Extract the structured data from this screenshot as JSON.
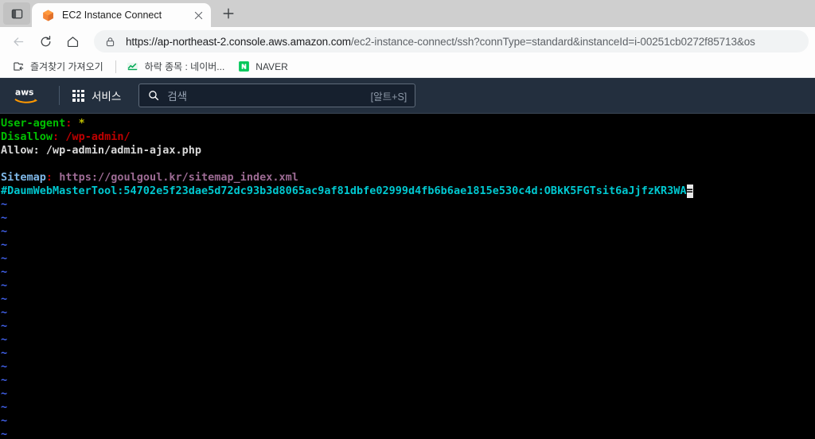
{
  "browser": {
    "tab": {
      "title": "EC2 Instance Connect",
      "favicon": "aws-ec2-cube-icon",
      "close_icon": "close-icon"
    },
    "new_tab_label": "+",
    "tab_search_icon": "tab-search-icon",
    "nav": {
      "back_icon": "back-arrow-icon",
      "reload_icon": "reload-icon",
      "home_icon": "home-icon"
    },
    "omnibox": {
      "lock_icon": "lock-icon",
      "scheme_host": "https://ap-northeast-2.console.aws.amazon.com",
      "path": "/ec2-instance-connect/ssh?connType=standard&instanceId=i-00251cb0272f85713&os"
    },
    "bookmarks": {
      "import_icon": "import-bookmarks-icon",
      "import_label": "즐겨찾기 가져오기",
      "items": [
        {
          "icon": "chart-icon",
          "label": "하락 종목 : 네이버..."
        },
        {
          "icon": "naver-n-icon",
          "label": "NAVER"
        }
      ]
    }
  },
  "aws": {
    "logo": "aws-logo",
    "services_grid_icon": "grid-menu-icon",
    "services_label": "서비스",
    "search": {
      "icon": "search-icon",
      "placeholder": "검색",
      "shortcut": "[알트+S]"
    }
  },
  "terminal": {
    "tilde": "~",
    "tilde_count": 18,
    "colors": {
      "background": "#000000",
      "green": "#00c000",
      "red": "#c00000",
      "yellow": "#c0c000",
      "white": "#d8d8d8",
      "light_blue": "#7fb8e8",
      "mauve": "#9d6b94",
      "teal": "#00c8d0",
      "tilde_blue": "#4060e8",
      "cursor": "#e8e8e8"
    },
    "lines": [
      {
        "id": "line-user-agent",
        "spans": [
          {
            "text": "User-agent",
            "color": "green"
          },
          {
            "text": ":",
            "color": "red"
          },
          {
            "text": " ",
            "color": "white"
          },
          {
            "text": "*",
            "color": "yellow"
          }
        ]
      },
      {
        "id": "line-disallow",
        "spans": [
          {
            "text": "Disallow",
            "color": "green"
          },
          {
            "text": ":",
            "color": "red"
          },
          {
            "text": " ",
            "color": "white"
          },
          {
            "text": "/wp-admin/",
            "color": "red"
          }
        ]
      },
      {
        "id": "line-allow",
        "spans": [
          {
            "text": "Allow: /wp-admin/admin-ajax.php",
            "color": "white"
          }
        ]
      },
      {
        "id": "line-blank",
        "spans": []
      },
      {
        "id": "line-sitemap",
        "spans": [
          {
            "text": "Sitemap",
            "color": "light_blue"
          },
          {
            "text": ":",
            "color": "red"
          },
          {
            "text": " ",
            "color": "white"
          },
          {
            "text": "https://goulgoul.kr/sitemap_index.xml",
            "color": "mauve"
          }
        ]
      },
      {
        "id": "line-daum-token",
        "spans": [
          {
            "text": "#DaumWebMasterTool:54702e5f23dae5d72dc93b3d8065ac9af81dbfe02999d4fb6b6ae1815e530c4d:OBkK5FGTsit6aJjfzKR3WA",
            "color": "teal"
          }
        ],
        "cursor": "="
      }
    ]
  }
}
